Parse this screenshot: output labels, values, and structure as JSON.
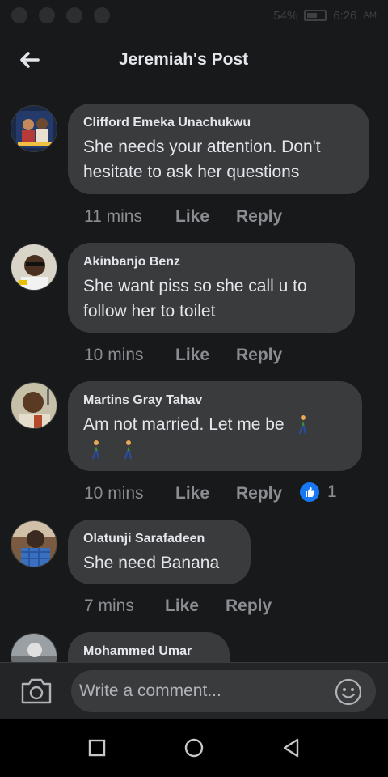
{
  "status_bar": {
    "battery": "54%",
    "time": "6:26",
    "time_suffix": "AM"
  },
  "header": {
    "title": "Jeremiah's Post",
    "back_icon": "back-arrow-icon"
  },
  "comments": [
    {
      "author": "Clifford Emeka Unachukwu",
      "text": "She needs your attention. Don't hesitate to ask her questions",
      "time": "11 mins",
      "like_label": "Like",
      "reply_label": "Reply"
    },
    {
      "author": "Akinbanjo Benz",
      "text": "She want piss so she call u to follow her to toilet",
      "time": "10 mins",
      "like_label": "Like",
      "reply_label": "Reply"
    },
    {
      "author": "Martins Gray Tahav",
      "text": "Am not married. Let me be",
      "time": "10 mins",
      "like_label": "Like",
      "reply_label": "Reply",
      "reaction_count": "1",
      "emoji_icon": "walking-person-icon"
    },
    {
      "author": "Olatunji Sarafadeen",
      "text": "She need Banana",
      "time": "7 mins",
      "like_label": "Like",
      "reply_label": "Reply"
    },
    {
      "author": "Mohammed Umar"
    }
  ],
  "composer": {
    "placeholder": "Write a comment...",
    "camera_icon": "camera-icon",
    "emoji_icon": "smiley-icon"
  },
  "colors": {
    "background": "#18191a",
    "bubble": "#3a3b3c",
    "accent": "#1877f2",
    "muted_text": "#8a8d91"
  }
}
